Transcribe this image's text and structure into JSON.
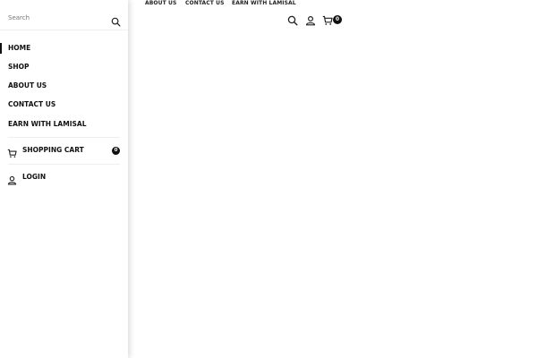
{
  "header": {
    "nav": [
      {
        "label": "ABOUT US"
      },
      {
        "label": "CONTACT US"
      },
      {
        "label": "EARN WITH LAMISAL"
      }
    ],
    "partial_glyph": "‹",
    "cart_count": "0",
    "icons": [
      "search-icon",
      "user-icon",
      "cart-icon"
    ]
  },
  "drawer": {
    "search": {
      "placeholder": "Search",
      "value": ""
    },
    "menu": [
      {
        "label": "HOME",
        "active": true
      },
      {
        "label": "SHOP"
      },
      {
        "label": "ABOUT US"
      },
      {
        "label": "CONTACT US"
      },
      {
        "label": "EARN WITH LAMISAL"
      }
    ],
    "cart": {
      "label": "SHOPPING CART",
      "count": "0"
    },
    "login": {
      "label": "LOGIN"
    }
  },
  "colors": {
    "text": "#111111",
    "background": "#ffffff",
    "badge": "#111111",
    "divider": "#eeeeee"
  }
}
